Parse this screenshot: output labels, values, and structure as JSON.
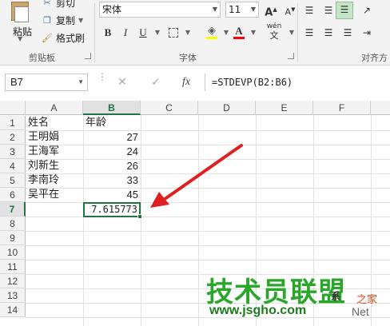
{
  "ribbon": {
    "clipboard": {
      "paste_label": "粘贴",
      "cut_label": "剪切",
      "copy_label": "复制",
      "format_painter_label": "格式刷",
      "group_label": "剪贴板"
    },
    "font": {
      "font_name": "宋体",
      "font_size": "11",
      "bold": "B",
      "italic": "I",
      "underline": "U",
      "fill_color": "#ffff00",
      "font_color": "#ff0000",
      "phonetic": "wén",
      "group_label": "字体"
    },
    "alignment": {
      "group_label": "对齐方"
    }
  },
  "formula_bar": {
    "name_box": "B7",
    "fx": "fx",
    "formula": "=STDEVP(B2:B6)"
  },
  "sheet": {
    "columns": [
      "A",
      "B",
      "C",
      "D",
      "E",
      "F"
    ],
    "selected_column": "B",
    "rows": [
      "1",
      "2",
      "3",
      "4",
      "5",
      "6",
      "7",
      "8",
      "9",
      "10",
      "11",
      "12",
      "13",
      "14"
    ],
    "selected_row": "7",
    "headers": {
      "name": "姓名",
      "age": "年龄"
    },
    "people": [
      {
        "name": "王明娟",
        "age": "27"
      },
      {
        "name": "王海军",
        "age": "24"
      },
      {
        "name": "刘新生",
        "age": "26"
      },
      {
        "name": "李南玲",
        "age": "33"
      },
      {
        "name": "吴平在",
        "age": "45"
      }
    ],
    "result": "7.615773"
  },
  "colors": {
    "accent": "#217346",
    "arrow": "#e02020"
  },
  "watermark": {
    "main": "技术员联盟",
    "url": "www.jsgho.com",
    "net": "Net",
    "home": "之家",
    "logo": "系"
  }
}
